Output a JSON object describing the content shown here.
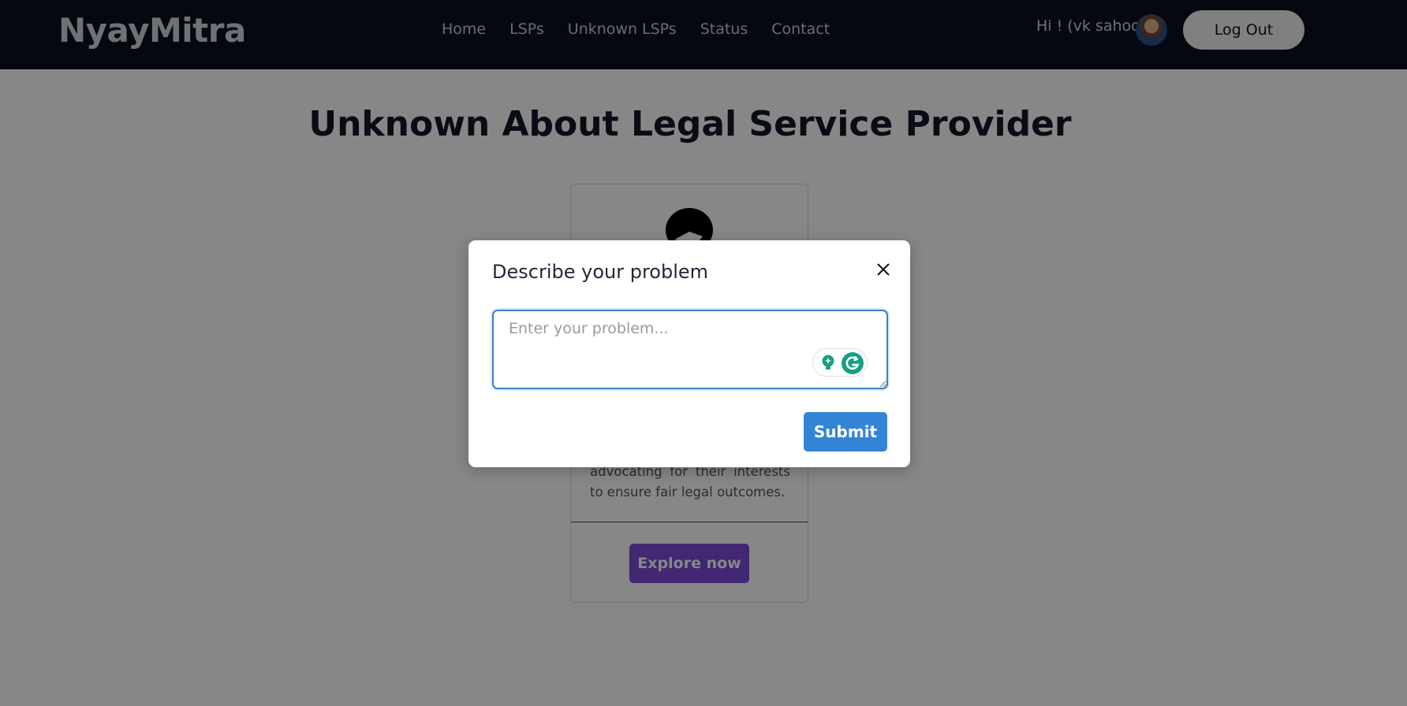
{
  "navbar": {
    "brand": "NyayMitra",
    "links": [
      "Home",
      "LSPs",
      "Unknown LSPs",
      "Status",
      "Contact"
    ],
    "greeting": "Hi ! (vk sahoo)",
    "logout_label": "Log Out"
  },
  "main": {
    "title": "Unknown About Legal Service Provider",
    "card": {
      "text": "advocating for their interests to ensure fair legal outcomes.",
      "button_label": "Explore now"
    }
  },
  "modal": {
    "title": "Describe your problem",
    "input_placeholder": "Enter your problem...",
    "input_value": "",
    "submit_label": "Submit"
  },
  "colors": {
    "navbar_bg": "#0a1020",
    "accent_blue": "#3484d6",
    "accent_purple": "#7d4bd8",
    "grammarly_green": "#15a085"
  }
}
